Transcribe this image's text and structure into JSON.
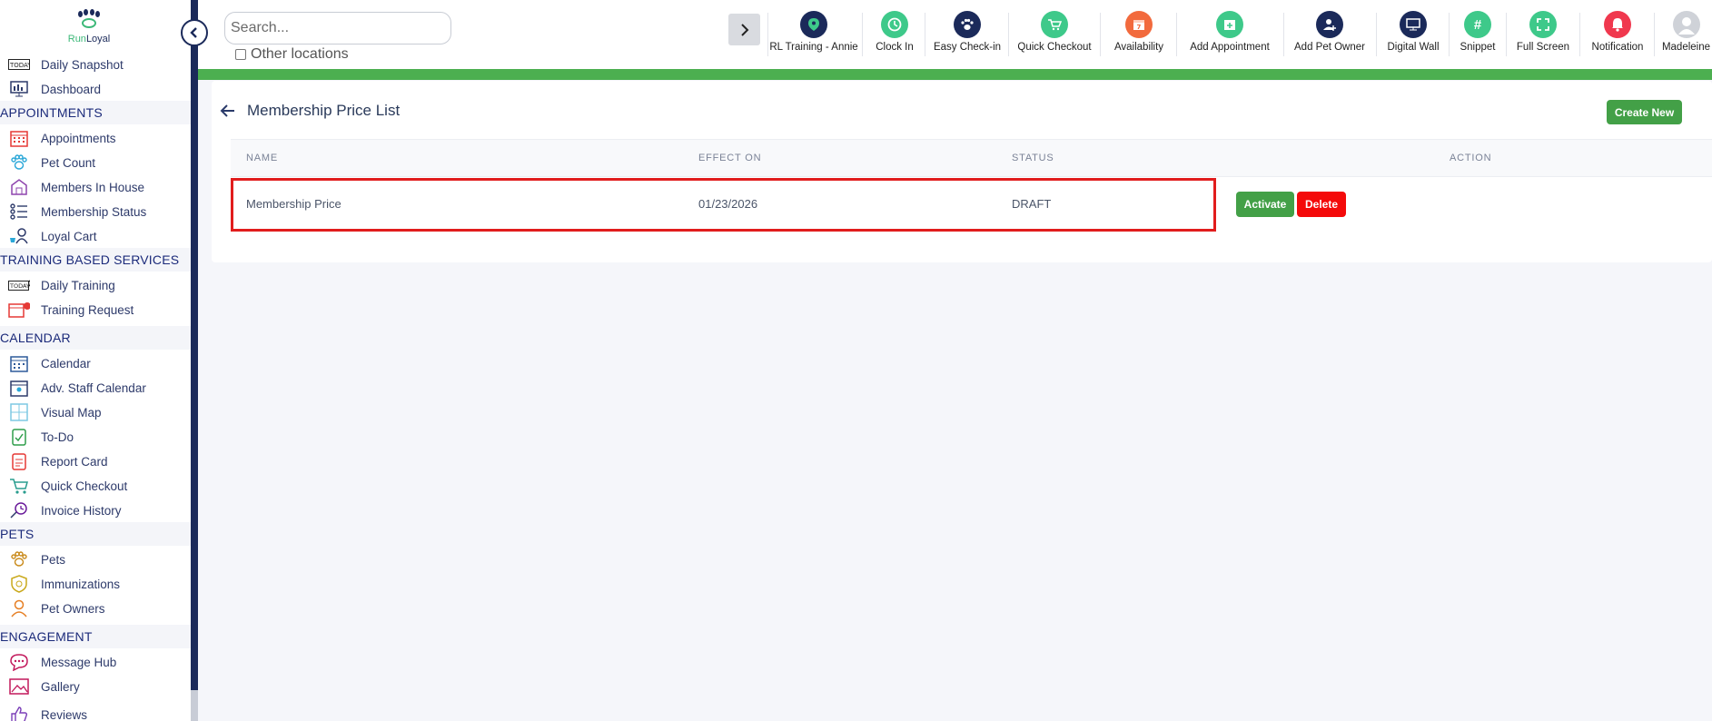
{
  "brand": {
    "name_part1": "Run",
    "name_part2": "Loyal"
  },
  "sidebar": {
    "items_top": [
      {
        "label": "Daily Snapshot",
        "icon": "today-icon"
      },
      {
        "label": "Dashboard",
        "icon": "dashboard-icon"
      }
    ],
    "sections": [
      {
        "title": "APPOINTMENTS",
        "items": [
          {
            "label": "Appointments",
            "icon": "calendar-grid-icon"
          },
          {
            "label": "Pet Count",
            "icon": "paw-icon"
          },
          {
            "label": "Members In House",
            "icon": "house-icon"
          },
          {
            "label": "Membership Status",
            "icon": "list-status-icon"
          },
          {
            "label": "Loyal Cart",
            "icon": "cart-person-icon"
          }
        ]
      },
      {
        "title": "TRAINING BASED SERVICES",
        "items": [
          {
            "label": "Daily Training",
            "icon": "today-training-icon"
          },
          {
            "label": "Training Request",
            "icon": "calendar-request-icon"
          }
        ]
      },
      {
        "title": "CALENDAR",
        "items": [
          {
            "label": "Calendar",
            "icon": "calendar-icon"
          },
          {
            "label": "Adv. Staff Calendar",
            "icon": "staff-calendar-icon"
          },
          {
            "label": "Visual Map",
            "icon": "map-grid-icon"
          },
          {
            "label": "To-Do",
            "icon": "todo-icon"
          },
          {
            "label": "Report Card",
            "icon": "report-card-icon"
          },
          {
            "label": "Quick Checkout",
            "icon": "checkout-cart-icon"
          },
          {
            "label": "Invoice History",
            "icon": "invoice-history-icon"
          }
        ]
      },
      {
        "title": "PETS",
        "items": [
          {
            "label": "Pets",
            "icon": "paw-icon"
          },
          {
            "label": "Immunizations",
            "icon": "shield-icon"
          },
          {
            "label": "Pet Owners",
            "icon": "person-icon"
          }
        ]
      },
      {
        "title": "ENGAGEMENT",
        "items": [
          {
            "label": "Message Hub",
            "icon": "chat-icon"
          },
          {
            "label": "Gallery",
            "icon": "gallery-icon"
          },
          {
            "label": "Reviews",
            "icon": "thumbs-up-icon"
          }
        ]
      }
    ]
  },
  "topbar": {
    "search_placeholder": "Search...",
    "other_locations_label": "Other locations",
    "tools": [
      {
        "label": "RL Training - Annie",
        "icon": "location-pin-icon",
        "color": "#1b2a5a"
      },
      {
        "label": "Clock In",
        "icon": "clock-icon",
        "color": "#3ec98a"
      },
      {
        "label": "Easy Check-in",
        "icon": "paw-icon",
        "color": "#1b2a5a"
      },
      {
        "label": "Quick Checkout",
        "icon": "cart-icon",
        "color": "#3ec98a"
      },
      {
        "label": "Availability",
        "icon": "calendar-icon",
        "color": "#f26a3d"
      },
      {
        "label": "Add Appointment",
        "icon": "calendar-add-icon",
        "color": "#3ec98a"
      },
      {
        "label": "Add Pet Owner",
        "icon": "add-person-icon",
        "color": "#1b2a5a"
      },
      {
        "label": "Digital Wall",
        "icon": "monitor-icon",
        "color": "#1b2a5a"
      },
      {
        "label": "Snippet",
        "icon": "hash-icon",
        "color": "#3ec98a"
      },
      {
        "label": "Full Screen",
        "icon": "expand-icon",
        "color": "#3ec98a"
      },
      {
        "label": "Notification",
        "icon": "bell-icon",
        "color": "#f0384e"
      },
      {
        "label": "Madeleine",
        "icon": "avatar-icon",
        "color": "#cfd2d8"
      }
    ]
  },
  "main": {
    "title": "Membership Price List",
    "create_new_label": "Create New",
    "columns": [
      "NAME",
      "EFFECT ON",
      "STATUS",
      "ACTION"
    ],
    "rows": [
      {
        "name": "Membership Price",
        "effect_on": "01/23/2026",
        "status": "DRAFT",
        "activate_label": "Activate",
        "delete_label": "Delete"
      }
    ]
  }
}
